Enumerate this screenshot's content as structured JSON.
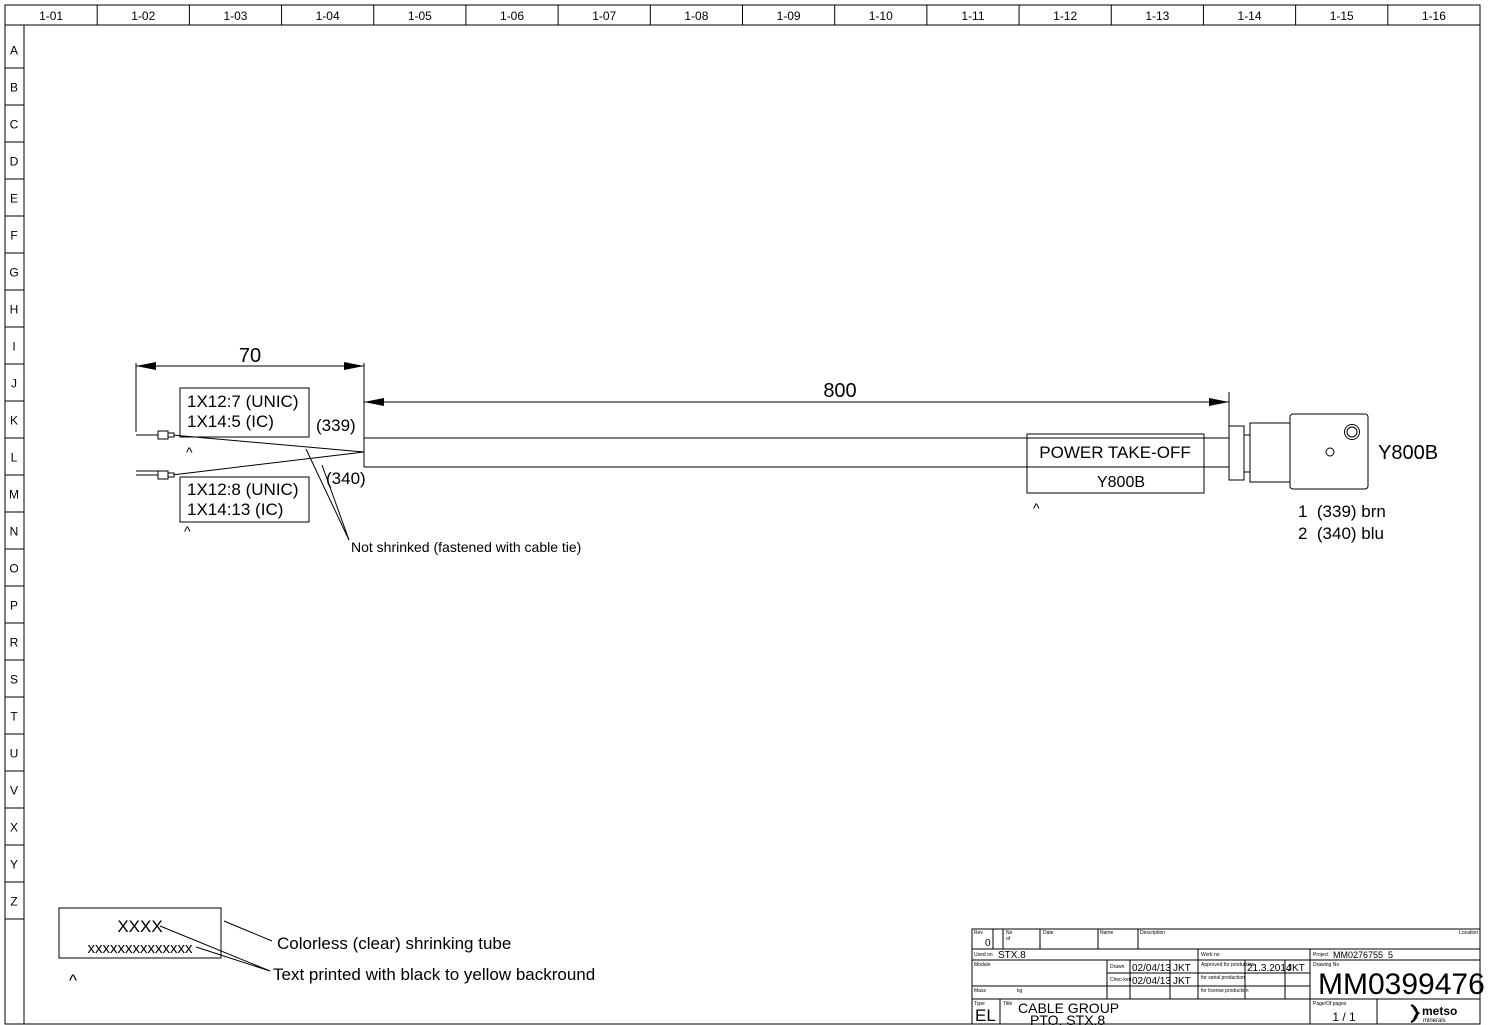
{
  "columns": [
    "1-01",
    "1-02",
    "1-03",
    "1-04",
    "1-05",
    "1-06",
    "1-07",
    "1-08",
    "1-09",
    "1-10",
    "1-11",
    "1-12",
    "1-13",
    "1-14",
    "1-15",
    "1-16"
  ],
  "rows": [
    "A",
    "B",
    "C",
    "D",
    "E",
    "F",
    "G",
    "H",
    "I",
    "J",
    "K",
    "L",
    "M",
    "N",
    "O",
    "P",
    "R",
    "S",
    "T",
    "U",
    "V",
    "X",
    "Y",
    "Z"
  ],
  "dimensions": {
    "left": "70",
    "main": "800"
  },
  "markers": {
    "top": {
      "line1": "1X12:7 (UNIC)",
      "line2": "1X14:5 (IC)",
      "wire": "(339)",
      "caret": "^"
    },
    "bottom": {
      "line1": "1X12:8 (UNIC)",
      "line2": "1X14:13 (IC)",
      "wire": "(340)",
      "caret": "^"
    }
  },
  "note_shrink": "Not shrinked (fastened with cable tie)",
  "function_label": {
    "title": "POWER TAKE-OFF",
    "code": "Y800B",
    "caret": "^"
  },
  "connector": {
    "label": "Y800B",
    "pins": [
      "1  (339) brn",
      "2  (340) blu"
    ]
  },
  "legend": {
    "code": "XXXX",
    "text": "xxxxxxxxxxxxxx",
    "caret": "^",
    "note1": "Colorless (clear) shrinking tube",
    "note2": "Text printed with black to yellow backround"
  },
  "title_block": {
    "rev_label": "Rev",
    "rev": "0",
    "no_label": "No",
    "of_label": "of",
    "date_label": "Date",
    "name_label": "Name",
    "desc_label": "Description",
    "location_label": "Location",
    "used_on_label": "Used on",
    "used_on": "STX.8",
    "module_label": "Module",
    "mass_label": "Mass",
    "mass_unit": "kg",
    "drawn_label": "Drawn",
    "drawn_date": "02/04/13",
    "drawn_by": "JKT",
    "checked_label": "Chec-ked",
    "checked_date": "02/04/13",
    "checked_by": "JKT",
    "work_no_label": "Work no",
    "approved_label": "Approved for production",
    "approved_date": "21.3.2014",
    "approved_by": "JKT",
    "serial_label": "for serial production",
    "license_label": "for license production",
    "project_label": "Project",
    "project": "MM0276755_5",
    "drawing_no_label": "Drawing No",
    "drawing_no": "MM0399476",
    "type_label": "Type",
    "type": "EL",
    "title_label": "Title",
    "title_line1": "CABLE GROUP",
    "title_line2": "PTO, STX.8",
    "pages_label": "Page/Of pages",
    "pages": "1 / 1",
    "logo_text": "metso",
    "logo_sub": "minerals"
  }
}
